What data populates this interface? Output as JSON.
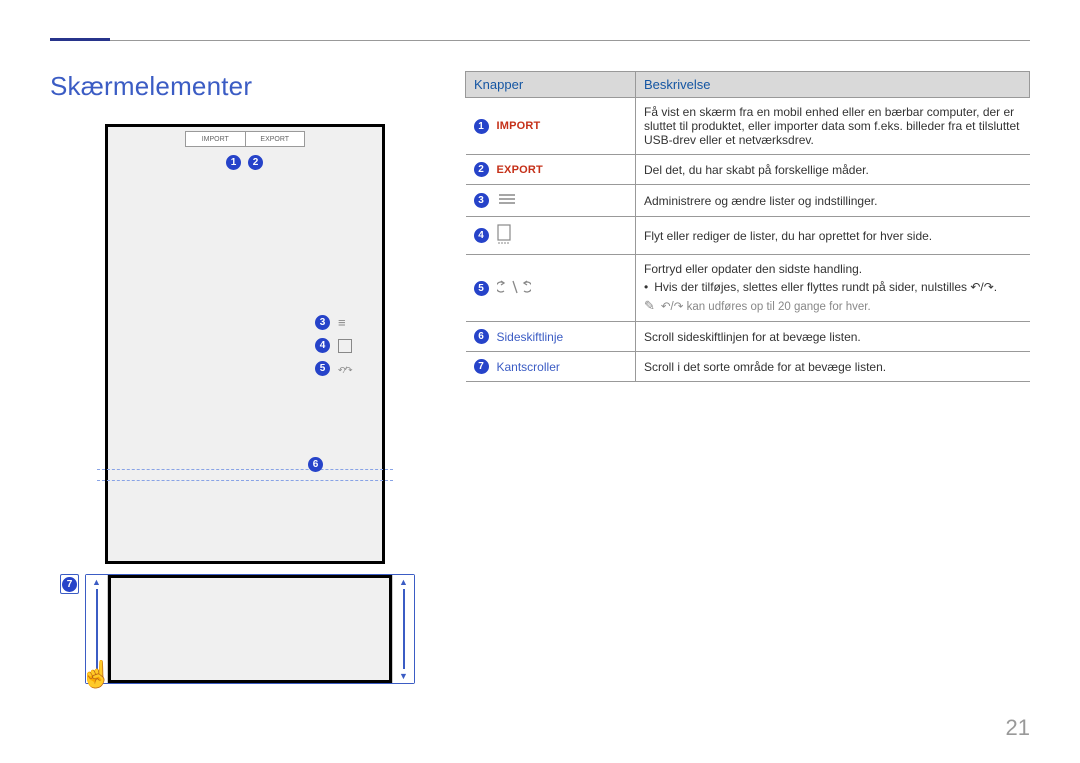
{
  "heading": "Skærmelementer",
  "page_number": "21",
  "table": {
    "headers": {
      "buttons": "Knapper",
      "description": "Beskrivelse"
    },
    "rows": [
      {
        "num": "1",
        "label": "IMPORT",
        "desc": "Få vist en skærm fra en mobil enhed eller en bærbar computer, der er sluttet til produktet, eller importer data som f.eks. billeder fra et tilsluttet USB-drev eller et netværksdrev."
      },
      {
        "num": "2",
        "label": "EXPORT",
        "desc": "Del det, du har skabt på forskellige måder."
      },
      {
        "num": "3",
        "label": "",
        "desc": "Administrere og ændre lister og indstillinger."
      },
      {
        "num": "4",
        "label": "",
        "desc": "Flyt eller rediger de lister, du har oprettet for hver side."
      },
      {
        "num": "5",
        "label": "",
        "desc_main": "Fortryd eller opdater den sidste handling.",
        "bullet": "Hvis der tilføjes, slettes eller flyttes rundt på sider, nulstilles ↶/↷.",
        "note": "↶/↷ kan udføres op til 20 gange for hver."
      },
      {
        "num": "6",
        "label": "Sideskiftlinje",
        "desc": "Scroll sideskiftlinjen for at bevæge listen."
      },
      {
        "num": "7",
        "label": "Kantscroller",
        "desc": "Scroll i det sorte område for at bevæge listen."
      }
    ]
  },
  "diagram": {
    "tab_left": "IMPORT",
    "tab_right": "EXPORT",
    "callouts": {
      "c1": "1",
      "c2": "2",
      "c3": "3",
      "c4": "4",
      "c5": "5",
      "c6": "6",
      "c7": "7"
    }
  }
}
